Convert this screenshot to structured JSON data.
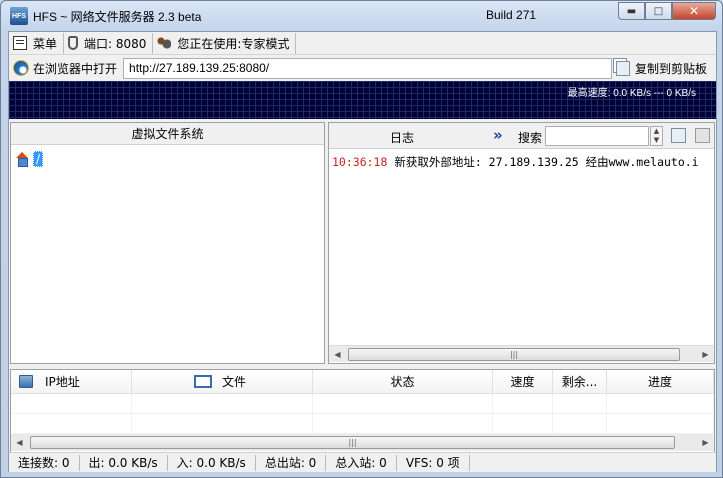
{
  "window": {
    "title": "HFS ~ 网络文件服务器 2.3 beta",
    "build": "Build 271",
    "app_icon_text": "HFS"
  },
  "toolbar": {
    "menu_label": "菜单",
    "port_label": "端口: 8080",
    "mode_label": "您正在使用:专家模式"
  },
  "urlbar": {
    "open_label": "在浏览器中打开",
    "url": "http://27.189.139.25:8080/",
    "copy_label": "复制到剪贴板"
  },
  "graph": {
    "label": "最高速度: 0.0 KB/s --- 0 KB/s"
  },
  "vfs": {
    "header": "虚拟文件系统",
    "root_label": "/"
  },
  "log": {
    "header": "日志",
    "search_label": "搜索",
    "entries": [
      {
        "time": "10:36:18",
        "message": "新获取外部地址: 27.189.139.25 经由www.melauto.i"
      }
    ]
  },
  "connections": {
    "columns": [
      "IP地址",
      "文件",
      "状态",
      "速度",
      "剩余...",
      "进度"
    ]
  },
  "statusbar": {
    "connections": "连接数: 0",
    "out": "出: 0.0 KB/s",
    "in": "入: 0.0 KB/s",
    "total_out": "总出站: 0",
    "total_in": "总入站: 0",
    "vfs": "VFS: 0 项"
  }
}
